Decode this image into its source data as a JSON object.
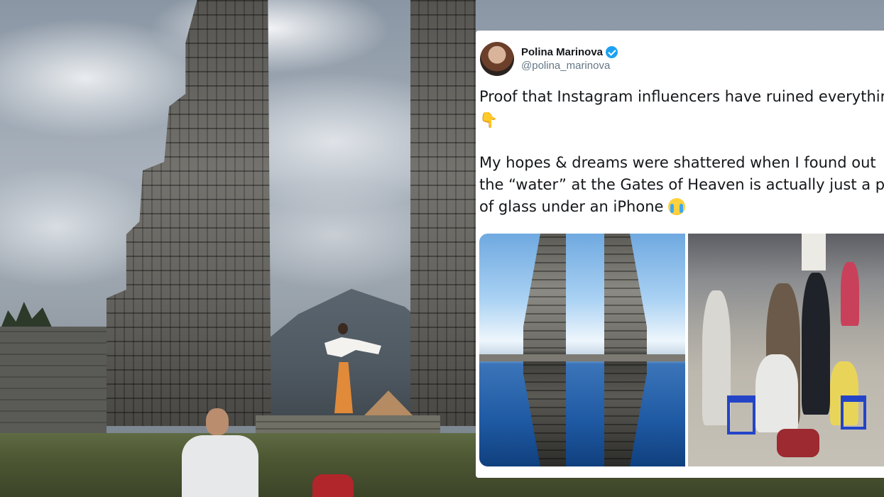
{
  "tweet": {
    "display_name": "Polina Marinova",
    "handle": "@polina_marinova",
    "verified": true,
    "line1": "Proof that Instagram influencers have ruined everything",
    "line2_emoji": "👇",
    "line3": "My hopes & dreams were shattered when I found out",
    "line4": "the “water” at the Gates of Heaven is actually just a piece",
    "line5": "of glass under an iPhone",
    "line5_emoji": "crying-face"
  },
  "colors": {
    "verified_badge": "#1da1f2",
    "handle_text": "#657786",
    "tweet_text": "#14171a"
  },
  "icons": {
    "verified": "verified-badge-icon",
    "pointing_down": "backhand-index-pointing-down-emoji",
    "crying": "loudly-crying-face-emoji"
  }
}
